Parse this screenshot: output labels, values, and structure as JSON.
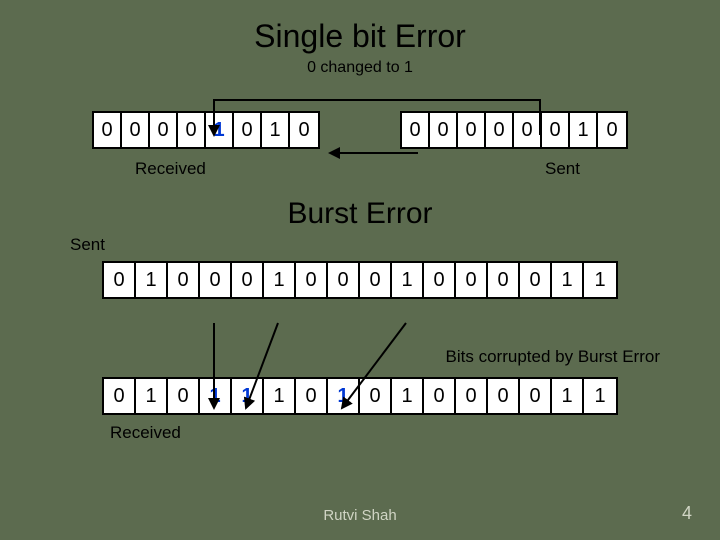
{
  "single_bit": {
    "title": "Single bit Error",
    "subtitle": "0 changed to 1",
    "received_bits": [
      "0",
      "0",
      "0",
      "0",
      "1",
      "0",
      "1",
      "0"
    ],
    "received_flip_indices": [
      4
    ],
    "sent_bits": [
      "0",
      "0",
      "0",
      "0",
      "0",
      "0",
      "1",
      "0"
    ],
    "received_label": "Received",
    "sent_label": "Sent"
  },
  "burst": {
    "title": "Burst Error",
    "sent_small_label": "Sent",
    "sent_bits": [
      "0",
      "1",
      "0",
      "0",
      "0",
      "1",
      "0",
      "0",
      "0",
      "1",
      "0",
      "0",
      "0",
      "0",
      "1",
      "1"
    ],
    "caption": "Bits corrupted by Burst Error",
    "received_bits": [
      "0",
      "1",
      "0",
      "1",
      "1",
      "1",
      "0",
      "1",
      "0",
      "1",
      "0",
      "0",
      "0",
      "0",
      "1",
      "1"
    ],
    "received_flip_indices": [
      3,
      4,
      7
    ],
    "received_label": "Received"
  },
  "footer": {
    "author": "Rutvi Shah",
    "page": "4"
  }
}
